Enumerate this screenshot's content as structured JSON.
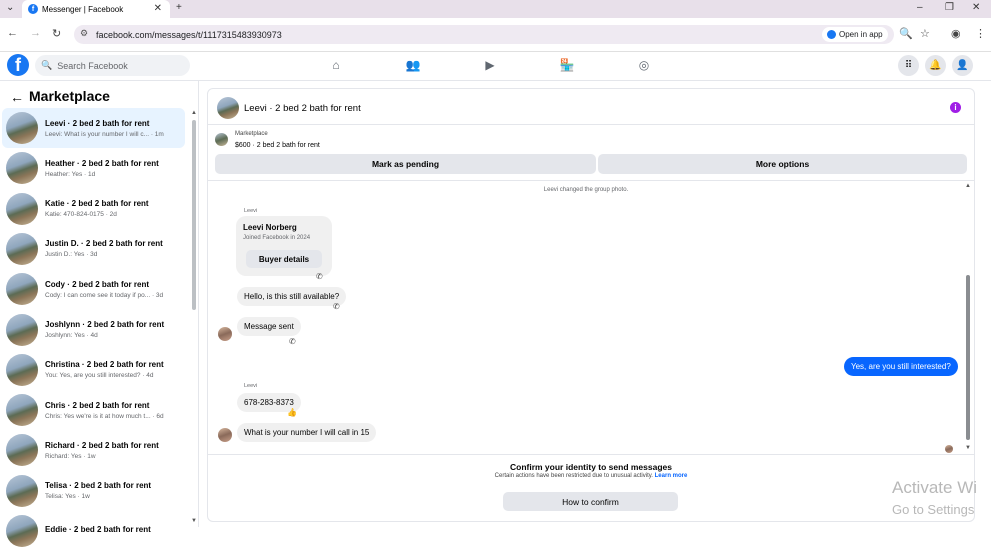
{
  "browser": {
    "tab_title": "Messenger | Facebook",
    "url": "facebook.com/messages/t/1117315483930973",
    "open_in_app": "Open in app"
  },
  "fb": {
    "logo": "f",
    "search_placeholder": "Search Facebook"
  },
  "sidebar": {
    "title": "Marketplace",
    "conversations": [
      {
        "name": "Leevi · 2 bed 2 bath for rent",
        "preview": "Leevi: What is your number I will c... · 1m"
      },
      {
        "name": "Heather · 2 bed 2 bath for rent",
        "preview": "Heather: Yes · 1d"
      },
      {
        "name": "Katie · 2 bed 2 bath for rent",
        "preview": "Katie: 470-824-0175 · 2d"
      },
      {
        "name": "Justin D. · 2 bed 2 bath for rent",
        "preview": "Justin D.: Yes · 3d"
      },
      {
        "name": "Cody · 2 bed 2 bath for rent",
        "preview": "Cody: I can come see it today if po... · 3d"
      },
      {
        "name": "Joshlynn · 2 bed 2 bath for rent",
        "preview": "Joshlynn: Yes · 4d"
      },
      {
        "name": "Christina · 2 bed 2 bath for rent",
        "preview": "You: Yes, are you still interested? · 4d"
      },
      {
        "name": "Chris · 2 bed 2 bath for rent",
        "preview": "Chris: Yes we're is it at how much t... · 6d"
      },
      {
        "name": "Richard · 2 bed 2 bath for rent",
        "preview": "Richard: Yes · 1w"
      },
      {
        "name": "Telisa · 2 bed 2 bath for rent",
        "preview": "Telisa: Yes · 1w"
      },
      {
        "name": "Eddie · 2 bed 2 bath for rent",
        "preview": ""
      }
    ]
  },
  "chat": {
    "title": "Leevi · 2 bed 2 bath for rent",
    "marketplace_label": "Marketplace",
    "listing": "$600 · 2 bed 2 bath for rent",
    "mark_pending": "Mark as pending",
    "more_options": "More options",
    "system_msg": "Leevi changed the group photo.",
    "sender": "Leevi",
    "card_name": "Leevi Norberg",
    "card_sub": "Joined Facebook in 2024",
    "card_btn": "Buyer details",
    "msg1": "Hello, is this still available?",
    "msg2": "Message sent",
    "msg3": "Yes, are you still interested?",
    "msg4": "678-283-8373",
    "reaction": "👍",
    "msg5": "What is your number I will call in 15",
    "confirm_title": "Confirm your identity to send messages",
    "confirm_sub": "Certain actions have been restricted due to unusual activity.",
    "learn_more": "Learn more",
    "confirm_btn": "How to confirm"
  },
  "watermark": {
    "line1": "Activate Wi",
    "line2": "Go to Settings"
  },
  "colors": {
    "brand": "#1877f2",
    "own_bubble": "#0866ff",
    "active_conv": "#e7f3ff"
  }
}
